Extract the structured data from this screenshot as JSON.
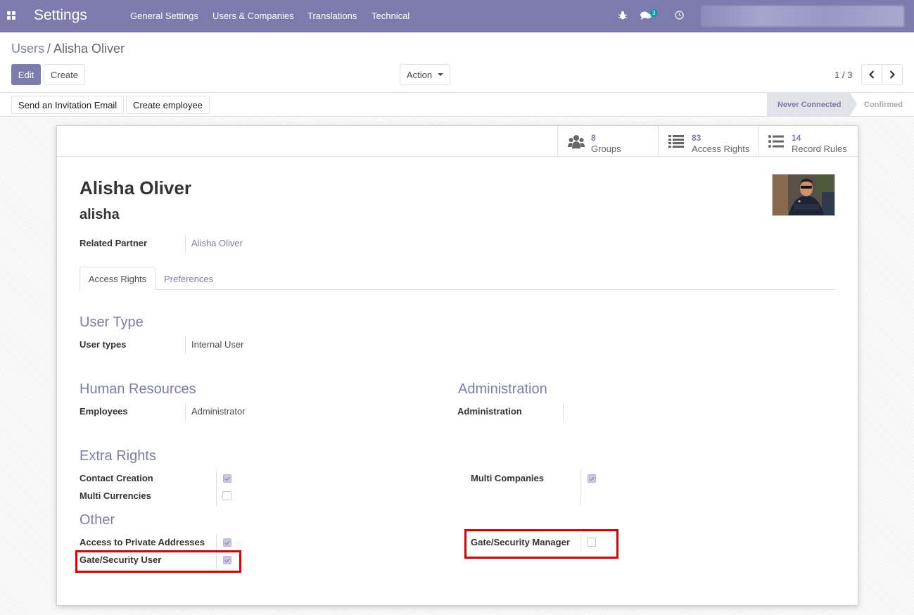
{
  "navbar": {
    "brand": "Settings",
    "menu": [
      "General Settings",
      "Users & Companies",
      "Translations",
      "Technical"
    ],
    "message_count": "3"
  },
  "breadcrumb": {
    "parent": "Users",
    "separator": "/",
    "current": "Alisha Oliver"
  },
  "buttons": {
    "edit": "Edit",
    "create": "Create",
    "action": "Action",
    "send_invitation": "Send an Invitation Email",
    "create_employee": "Create employee"
  },
  "pager": {
    "value": "1 / 3"
  },
  "status": {
    "active": "Never Connected",
    "next": "Confirmed"
  },
  "smart_buttons": [
    {
      "count": "8",
      "label": "Groups",
      "icon": "users-icon"
    },
    {
      "count": "83",
      "label": "Access Rights",
      "icon": "list-icon"
    },
    {
      "count": "14",
      "label": "Record Rules",
      "icon": "list-ul-icon"
    }
  ],
  "user": {
    "name": "Alisha Oliver",
    "login": "alisha",
    "related_partner_label": "Related Partner",
    "related_partner": "Alisha Oliver"
  },
  "tabs": [
    "Access Rights",
    "Preferences"
  ],
  "sections": {
    "user_type": {
      "title": "User Type",
      "field_label": "User types",
      "field_value": "Internal User"
    },
    "human_resources": {
      "title": "Human Resources",
      "field_label": "Employees",
      "field_value": "Administrator"
    },
    "administration": {
      "title": "Administration",
      "field_label": "Administration",
      "field_value": ""
    },
    "extra_rights": {
      "title": "Extra Rights",
      "items": [
        {
          "label": "Contact Creation",
          "checked": true
        },
        {
          "label": "Multi Currencies",
          "checked": false
        },
        {
          "label": "Multi Companies",
          "checked": true
        }
      ]
    },
    "other": {
      "title": "Other",
      "items": [
        {
          "label": "Access to Private Addresses",
          "checked": true
        },
        {
          "label": "Gate/Security User",
          "checked": true
        },
        {
          "label": "Gate/Security Manager",
          "checked": false
        }
      ]
    }
  },
  "colors": {
    "brand": "#7c7bad",
    "highlight": "#e00000"
  }
}
